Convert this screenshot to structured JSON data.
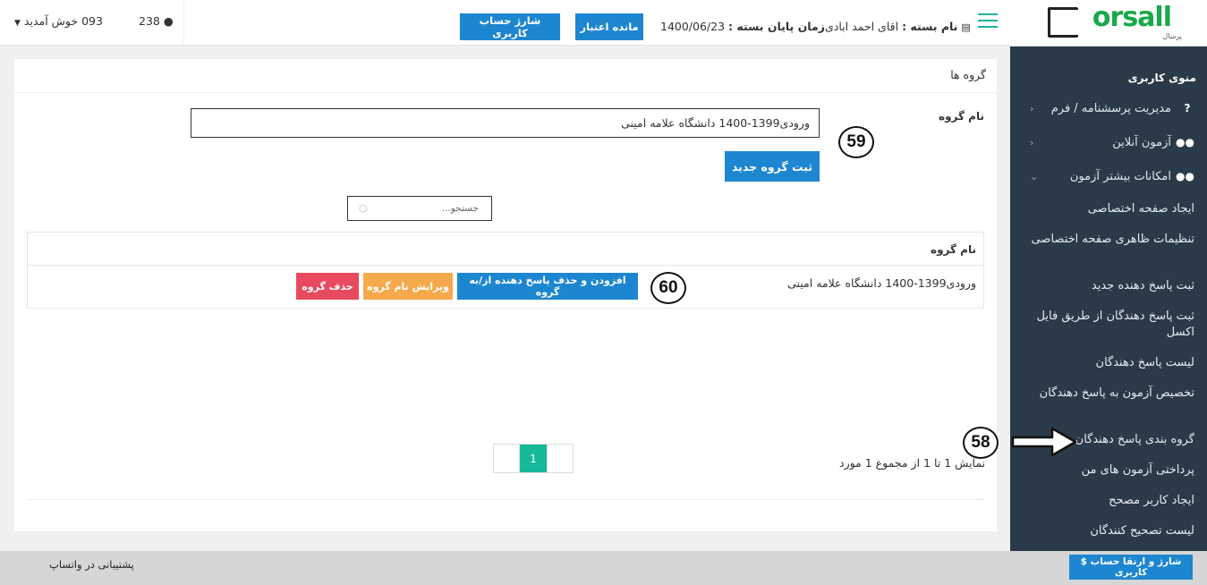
{
  "brand": {
    "logo_main": "orsall",
    "logo_sub": "پرسال"
  },
  "sidebar": {
    "menu_title": "منوی کاربری",
    "items": [
      {
        "label": "مدیریت پرسشنامه / فرم",
        "icon": "?",
        "arrow": "‹"
      },
      {
        "label": "آزمون آنلاین",
        "icon": "users-icon",
        "arrow": "‹"
      },
      {
        "label": "امکانات بیشتر آزمون",
        "icon": "users-icon",
        "arrow": "⌄"
      }
    ],
    "sub_items": [
      "ایجاد صفحه اختصاصی",
      "تنظیمات ظاهری صفحه اختصاصی",
      "ثبت پاسخ دهنده جدید",
      "ثبت پاسخ دهندگان از طریق فایل اکسل",
      "لیست پاسخ دهندگان",
      "تخصیص آزمون به پاسخ دهندگان",
      "گروه بندی پاسخ دهندگان",
      "پرداختی آزمون های من",
      "ایجاد کاربر مصحح",
      "لیست تصحیح کنندگان"
    ],
    "charge_button": "$ شارژ و ارتقا حساب کاربری"
  },
  "header": {
    "package_label": "نام بسته :",
    "package_value": "اقای احمد ابادی",
    "end_label": "زمان پایان بسته :",
    "end_value": "1400/06/23",
    "balance_button": "مانده اعتبار",
    "charge_button": "شارژ حساب کاربری",
    "user_count": "238",
    "welcome": "093 خوش آمدید"
  },
  "main": {
    "panel_title": "گروه ها",
    "group_name_label": "نام گروه",
    "group_name_value": "ورودی1399-1400 دانشگاه علامه امینی",
    "submit_button": "ثبت گروه جدید",
    "search_placeholder": "جستجو...",
    "table": {
      "header": "نام گروه",
      "rows": [
        {
          "name": "ورودی1399-1400 دانشگاه علامه امینی",
          "add_remove_button": "افزودن و حذف پاسخ دهنده از/به گروه",
          "edit_button": "ویرایش نام گروه",
          "delete_button": "حذف گروه"
        }
      ]
    },
    "pagination": {
      "info": "نمایش 1 تا 1 از مجموع 1 مورد",
      "current_page": "1"
    }
  },
  "annotations": {
    "badge_58": "58",
    "badge_59": "59",
    "badge_60": "60"
  },
  "footer": {
    "support_text": "پشتیبانی در واتساپ"
  },
  "colors": {
    "primary": "#1d86d0",
    "teal": "#17b89a",
    "orange": "#f5a94a",
    "red": "#e84a5f",
    "sidebar_bg": "#2b3a48"
  }
}
